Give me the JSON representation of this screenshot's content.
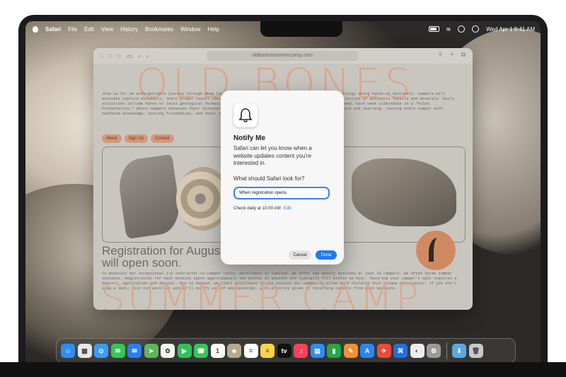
{
  "menubar": {
    "app": "Safari",
    "items": [
      "File",
      "Edit",
      "View",
      "History",
      "Bookmarks",
      "Window",
      "Help"
    ],
    "datetime": "Wed Apr 1  9:41 AM"
  },
  "browser": {
    "url": "oldbonessummercamp.com"
  },
  "website": {
    "hero_top": "OLD BONES",
    "intro": "Join us for an unforgettable journey through deep time! Old Bones Summer Camp blends adventure and paleontology using hands-on discovery. Campers will excavate replica dinosaurs, learn proper fossil identification techniques, and build their own growing collection of authentic fossils and minerals. Daily activities include hikes to local geological formations and field trips, with an overnight expedition weekend. Each week culminates in a \"Paleo Presentation,\" where campers showcase their discoveries with families. Old Bones Summer Camp blends adventure and learning, leaving every camper with newfound knowledge, lasting friendships, and their very own fossil to take home.",
    "nav": [
      "About",
      "Sign Up",
      "Contact"
    ],
    "registration": "Registration for August will open soon.",
    "body": "To maintain our exceptional 1:6 instructor-to-camper ratio, enrollment is limited. We offer two weekly sessions at just 24 campers. We often three summer sessions. Registration for each session opens approximately two months in advance and typically fill within an hour. Securing your camper's spot requires a deposit, application and deposit. Due to demand, we limit enrollment to one session per camper to allow more children this unique opportunity. If you don't snag a spot, join our waitlist and we'll notify you of any openings, with priority given to returning campers from past sessions.",
    "hero_bottom": "SUMMER CAMP"
  },
  "dialog": {
    "title": "Notify Me",
    "description": "Safari can let you know when a website updates content you're interested in.",
    "question": "What should Safari look for?",
    "input_value": "When registration opens",
    "check_text": "Check daily at 10:00 AM",
    "edit_label": "Edit",
    "cancel_label": "Cancel",
    "done_label": "Done"
  },
  "dock": {
    "apps": [
      {
        "name": "finder-icon",
        "color": "#2f8cf2",
        "glyph": "☺"
      },
      {
        "name": "launchpad-icon",
        "color": "#e7e7ea",
        "glyph": "▦"
      },
      {
        "name": "safari-icon",
        "color": "#3a9cf5",
        "glyph": "⊙"
      },
      {
        "name": "messages-icon",
        "color": "#34c759",
        "glyph": "✉"
      },
      {
        "name": "mail-icon",
        "color": "#2a7ef5",
        "glyph": "✉"
      },
      {
        "name": "maps-icon",
        "color": "#5fb65a",
        "glyph": "➤"
      },
      {
        "name": "photos-icon",
        "color": "#f6f6f6",
        "glyph": "✿"
      },
      {
        "name": "facetime-icon",
        "color": "#33c25a",
        "glyph": "▶"
      },
      {
        "name": "phone-icon",
        "color": "#34c759",
        "glyph": "☎"
      },
      {
        "name": "calendar-icon",
        "color": "#ffffff",
        "glyph": "1"
      },
      {
        "name": "contacts-icon",
        "color": "#b8a98e",
        "glyph": "☻"
      },
      {
        "name": "reminders-icon",
        "color": "#ffffff",
        "glyph": "≡"
      },
      {
        "name": "notes-icon",
        "color": "#fbd34a",
        "glyph": "≡"
      },
      {
        "name": "tv-icon",
        "color": "#111111",
        "glyph": "tv"
      },
      {
        "name": "music-icon",
        "color": "#f7425a",
        "glyph": "♫"
      },
      {
        "name": "keynote-icon",
        "color": "#2d8df0",
        "glyph": "▤"
      },
      {
        "name": "numbers-icon",
        "color": "#27a745",
        "glyph": "▮"
      },
      {
        "name": "pages-icon",
        "color": "#f09036",
        "glyph": "✎"
      },
      {
        "name": "app-store-icon",
        "color": "#2a86f5",
        "glyph": "A"
      },
      {
        "name": "testflight-icon",
        "color": "#e9493a",
        "glyph": "✈"
      },
      {
        "name": "xcode-icon",
        "color": "#1e6fe0",
        "glyph": "⌘"
      },
      {
        "name": "screen-time-icon",
        "color": "#ededed",
        "glyph": "◐"
      },
      {
        "name": "settings-icon",
        "color": "#9a9a9e",
        "glyph": "⚙"
      }
    ],
    "extras": [
      {
        "name": "downloads-folder-icon",
        "color": "#5aa8e8",
        "glyph": "⬇"
      },
      {
        "name": "trash-icon",
        "color": "#c9c9cc",
        "glyph": "🗑"
      }
    ]
  }
}
